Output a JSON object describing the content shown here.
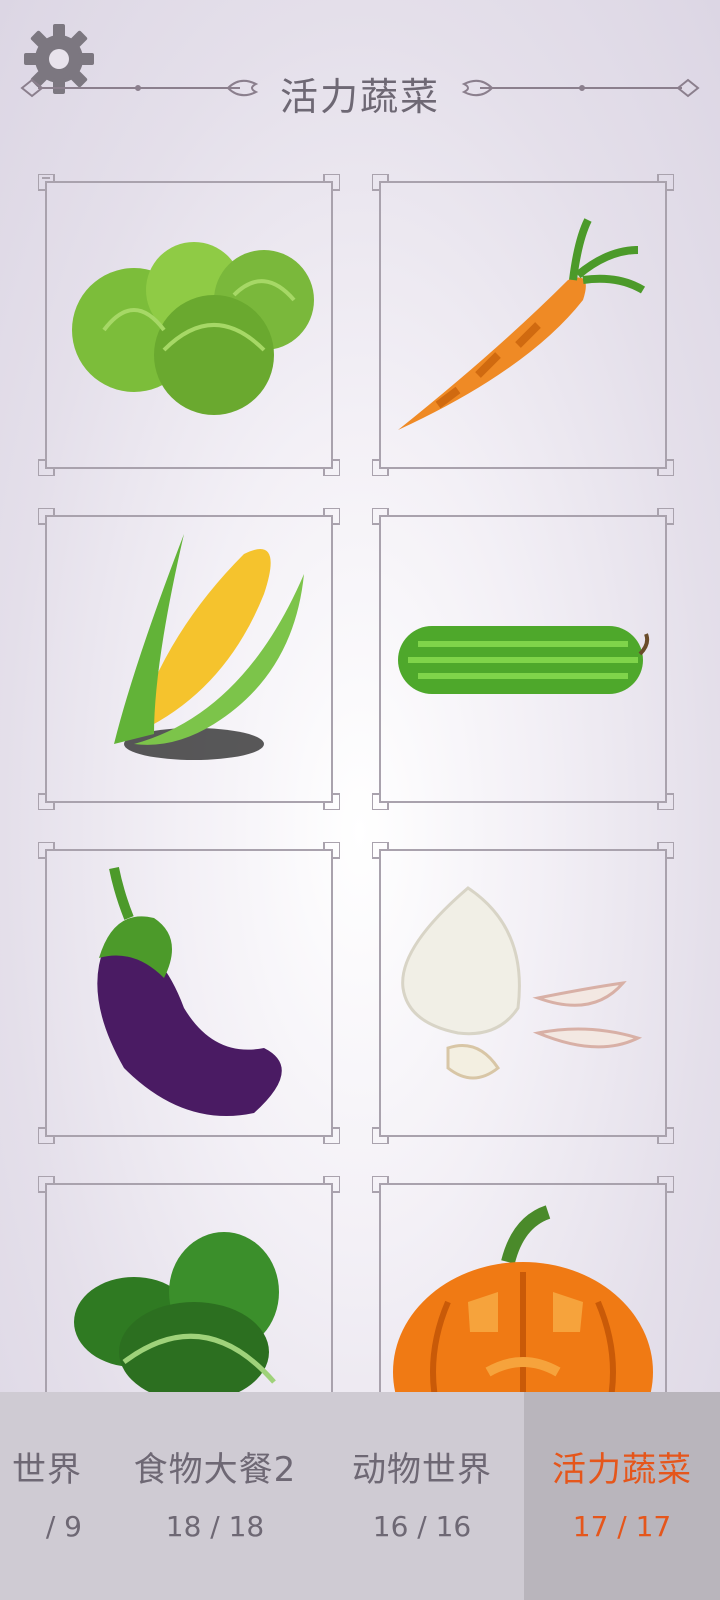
{
  "header": {
    "title": "活力蔬菜",
    "settings_icon": "gear-icon"
  },
  "grid": {
    "items": [
      {
        "name": "cabbage"
      },
      {
        "name": "carrot"
      },
      {
        "name": "corn"
      },
      {
        "name": "cucumber"
      },
      {
        "name": "eggplant"
      },
      {
        "name": "garlic"
      },
      {
        "name": "spinach"
      },
      {
        "name": "pumpkin"
      }
    ]
  },
  "tabs": [
    {
      "label": "世界",
      "progress": "/ 9"
    },
    {
      "label": "食物大餐2",
      "progress": "18 / 18"
    },
    {
      "label": "动物世界",
      "progress": "16 / 16"
    },
    {
      "label": "活力蔬菜",
      "progress": "17 / 17",
      "active": true
    }
  ],
  "colors": {
    "accent": "#e5561b",
    "text": "#6e6874",
    "tab_bar": "#cfcbd3",
    "tab_active": "#b9b5bc"
  }
}
